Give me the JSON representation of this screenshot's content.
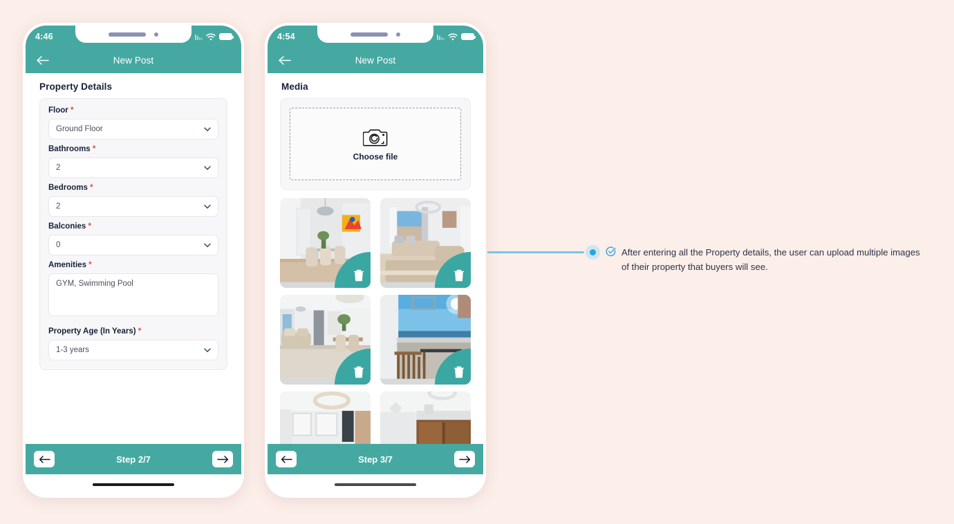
{
  "background_color": "#fceee9",
  "accent_color": "#45a9a2",
  "phones": [
    {
      "id": "phone-property-details",
      "status": {
        "time": "4:46",
        "signal_icon": "signal-bars-icon",
        "wifi_icon": "wifi-icon",
        "battery_icon": "battery-icon"
      },
      "appbar": {
        "back_icon": "back-arrow-icon",
        "title": "New Post"
      },
      "section_title": "Property Details",
      "fields": [
        {
          "label": "Floor",
          "required": "*",
          "type": "select",
          "value": "Ground Floor"
        },
        {
          "label": "Bathrooms",
          "required": "*",
          "type": "select",
          "value": "2"
        },
        {
          "label": "Bedrooms",
          "required": "*",
          "type": "select",
          "value": "2"
        },
        {
          "label": "Balconies",
          "required": "*",
          "type": "select",
          "value": "0"
        },
        {
          "label": "Amenities",
          "required": "*",
          "type": "textarea",
          "value": "GYM, Swimming Pool"
        },
        {
          "label": "Property Age (In Years)",
          "required": "*",
          "type": "select",
          "value": "1-3 years"
        }
      ],
      "stepbar": {
        "prev_icon": "arrow-left-icon",
        "label": "Step 2/7",
        "next_icon": "arrow-right-icon"
      }
    },
    {
      "id": "phone-media",
      "status": {
        "time": "4:54",
        "signal_icon": "signal-bars-icon",
        "wifi_icon": "wifi-icon",
        "battery_icon": "battery-icon"
      },
      "appbar": {
        "back_icon": "back-arrow-icon",
        "title": "New Post"
      },
      "section_title": "Media",
      "upload": {
        "icon": "camera-icon",
        "label": "Choose file"
      },
      "thumbnails": [
        {
          "alt": "dining-room-photo",
          "delete_icon": "trash-icon"
        },
        {
          "alt": "living-room-window-photo",
          "delete_icon": "trash-icon"
        },
        {
          "alt": "open-plan-living-photo",
          "delete_icon": "trash-icon"
        },
        {
          "alt": "sea-view-balcony-photo",
          "delete_icon": "trash-icon"
        },
        {
          "alt": "bedroom-ceiling-light-photo",
          "delete_icon": "trash-icon"
        },
        {
          "alt": "kitchen-cabinet-photo",
          "delete_icon": "trash-icon"
        }
      ],
      "stepbar": {
        "prev_icon": "arrow-left-icon",
        "label": "Step 3/7",
        "next_icon": "arrow-right-icon"
      }
    }
  ],
  "annotation": {
    "marker_icon": "callout-dot-marker",
    "check_icon": "check-circle-icon",
    "text": "After entering all the Property details, the user can upload multiple images of their property that buyers will see.",
    "line_color": "#7cc4e3",
    "dot_color": "#2ba4de"
  }
}
